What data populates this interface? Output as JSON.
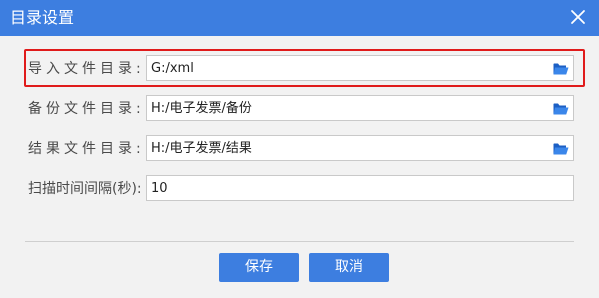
{
  "dialog": {
    "title": "目录设置"
  },
  "fields": [
    {
      "label": "导入文件目录:",
      "value": "G:/xml",
      "icon": "folder-icon"
    },
    {
      "label": "备份文件目录:",
      "value": "H:/电子发票/备份",
      "icon": "folder-icon"
    },
    {
      "label": "结果文件目录:",
      "value": "H:/电子发票/结果",
      "icon": "folder-icon"
    },
    {
      "label": "扫描时间间隔(秒):",
      "value": "10"
    }
  ],
  "buttons": {
    "save": "保存",
    "cancel": "取消"
  },
  "colors": {
    "titlebar": "#3d7ee0",
    "button": "#3d7ee0",
    "highlight_border": "#e01b1b",
    "folder_icon": "#2a6fd6"
  }
}
